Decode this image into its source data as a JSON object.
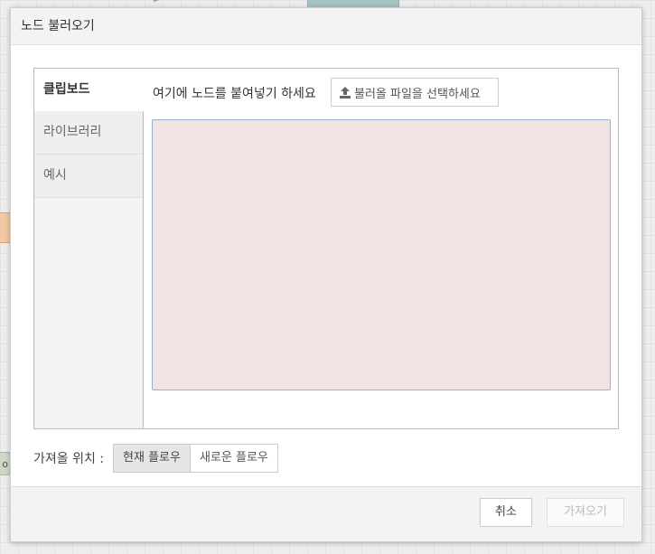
{
  "dialog": {
    "title": "노드 불러오기",
    "tabs": [
      {
        "label": "클립보드",
        "active": true
      },
      {
        "label": "라이브러리",
        "active": false
      },
      {
        "label": "예시",
        "active": false
      }
    ],
    "clipboard": {
      "hint": "여기에 노드를 붙여넣기 하세요",
      "file_button_label": "불러올 파일을 선택하세요",
      "file_button_icon": "upload-icon",
      "paste_value": ""
    },
    "import_target": {
      "label": "가져올 위치 :",
      "options": [
        {
          "label": "현재 플로우",
          "selected": true
        },
        {
          "label": "새로운 플로우",
          "selected": false
        }
      ]
    },
    "footer": {
      "cancel_label": "취소",
      "import_label": "가져오기",
      "import_enabled": false
    }
  },
  "background": {
    "node_left_partial_text": "o"
  },
  "colors": {
    "paste_area_bg": "#f1e3e3",
    "paste_area_border": "#9db0d0"
  }
}
